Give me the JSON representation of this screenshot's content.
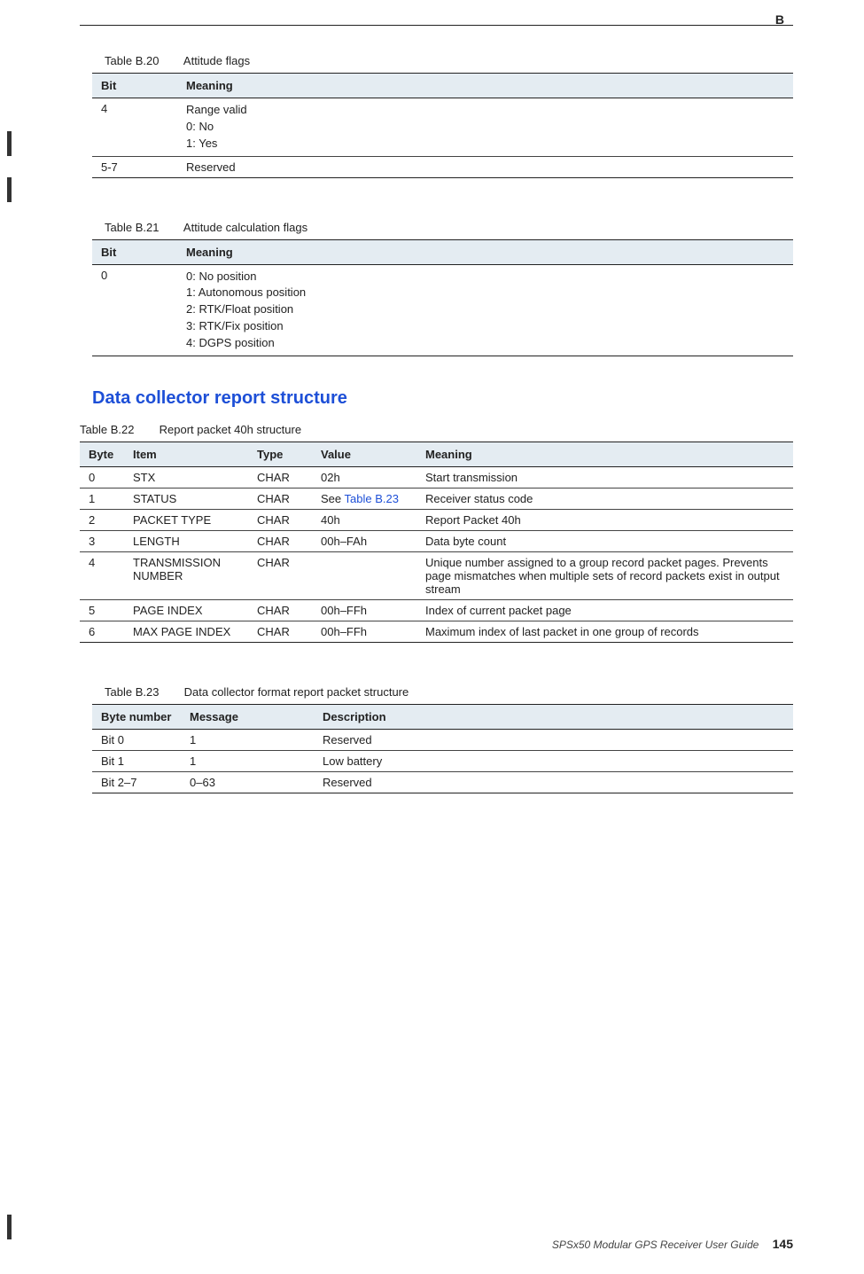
{
  "appendix_letter": "B",
  "tables": {
    "t20": {
      "caption_num": "Table B.20",
      "caption_title": "Attitude flags",
      "headers": {
        "bit": "Bit",
        "meaning": "Meaning"
      },
      "rows": [
        {
          "bit": "4",
          "meaning": [
            "Range valid",
            "0: No",
            "1: Yes"
          ]
        },
        {
          "bit": "5-7",
          "meaning": [
            "Reserved"
          ]
        }
      ]
    },
    "t21": {
      "caption_num": "Table B.21",
      "caption_title": "Attitude calculation flags",
      "headers": {
        "bit": "Bit",
        "meaning": "Meaning"
      },
      "rows": [
        {
          "bit": "0",
          "meaning": [
            "0: No position",
            "1: Autonomous position",
            "2: RTK/Float position",
            "3: RTK/Fix position",
            "4: DGPS position"
          ]
        }
      ]
    },
    "t22": {
      "caption_num": "Table B.22",
      "caption_title": "Report packet 40h structure",
      "headers": {
        "byte": "Byte",
        "item": "Item",
        "type": "Type",
        "value": "Value",
        "meaning": "Meaning"
      },
      "rows": [
        {
          "byte": "0",
          "item": "STX",
          "type": "CHAR",
          "value": "02h",
          "meaning": "Start transmission"
        },
        {
          "byte": "1",
          "item": "STATUS",
          "type": "CHAR",
          "value_prefix": "See ",
          "value_link": "Table B.23",
          "meaning": "Receiver status code"
        },
        {
          "byte": "2",
          "item": "PACKET TYPE",
          "type": "CHAR",
          "value": "40h",
          "meaning": "Report Packet 40h"
        },
        {
          "byte": "3",
          "item": "LENGTH",
          "type": "CHAR",
          "value": "00h–FAh",
          "meaning": "Data byte count"
        },
        {
          "byte": "4",
          "item": "TRANSMISSION NUMBER",
          "type": "CHAR",
          "value": "",
          "meaning": "Unique number assigned to a group record packet pages. Prevents page mismatches when multiple sets of record packets exist in output stream"
        },
        {
          "byte": "5",
          "item": "PAGE INDEX",
          "type": "CHAR",
          "value": "00h–FFh",
          "meaning": "Index of current packet page"
        },
        {
          "byte": "6",
          "item": "MAX PAGE INDEX",
          "type": "CHAR",
          "value": "00h–FFh",
          "meaning": "Maximum index of last packet in one group of records"
        }
      ]
    },
    "t23": {
      "caption_num": "Table B.23",
      "caption_title": "Data collector format report packet structure",
      "headers": {
        "byte_number": "Byte number",
        "message": "Message",
        "description": "Description"
      },
      "rows": [
        {
          "byte_number": "Bit 0",
          "message": "1",
          "description": "Reserved"
        },
        {
          "byte_number": "Bit 1",
          "message": "1",
          "description": "Low battery"
        },
        {
          "byte_number": "Bit 2–7",
          "message": "0–63",
          "description": "Reserved"
        }
      ]
    }
  },
  "section_heading": "Data collector report structure",
  "footer": {
    "title": "SPSx50 Modular GPS Receiver User Guide",
    "page": "145"
  }
}
